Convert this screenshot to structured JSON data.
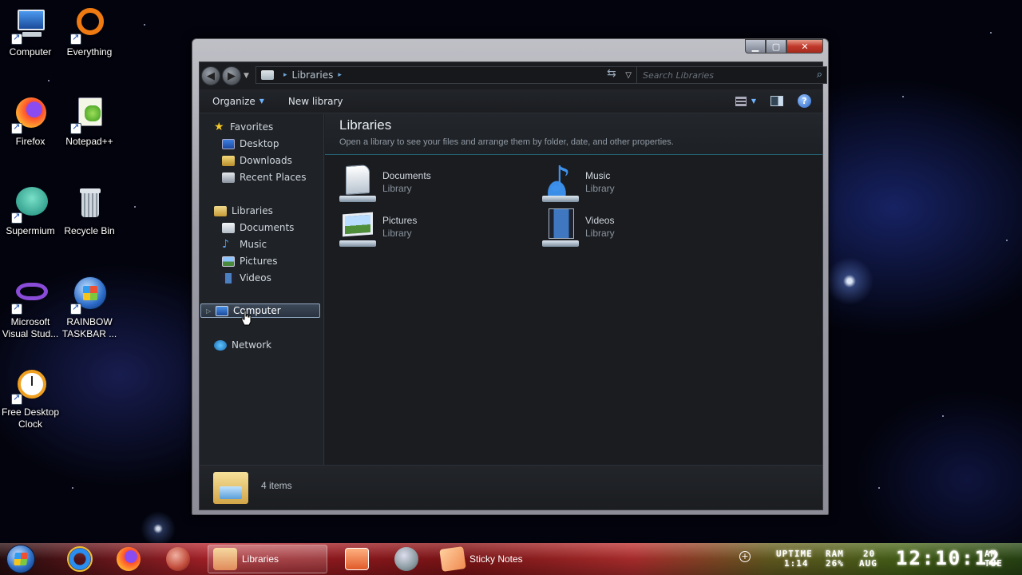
{
  "desktop": {
    "icons": [
      {
        "label": "Computer",
        "icon": "computer-icon"
      },
      {
        "label": "Everything",
        "icon": "everything-icon"
      },
      {
        "label": "Firefox",
        "icon": "firefox-icon"
      },
      {
        "label": "Notepad++",
        "icon": "notepad-plus-plus-icon"
      },
      {
        "label": "Supermium",
        "icon": "supermium-icon"
      },
      {
        "label": "Recycle Bin",
        "icon": "recycle-bin-icon"
      },
      {
        "label": "Microsoft Visual Stud...",
        "icon": "visual-studio-icon"
      },
      {
        "label": "RAINBOW TASKBAR ...",
        "icon": "rainbow-taskbar-icon"
      },
      {
        "label": "Free Desktop Clock",
        "icon": "alarm-clock-icon"
      }
    ]
  },
  "window": {
    "caption": {
      "minimize": "▁",
      "maximize": "▢",
      "close": "✕"
    },
    "address": {
      "crumb": "Libraries"
    },
    "search": {
      "placeholder": "Search Libraries"
    },
    "toolbar": {
      "organize": "Organize",
      "new_library": "New library"
    },
    "nav": {
      "favorites": "Favorites",
      "favorites_items": [
        "Desktop",
        "Downloads",
        "Recent Places"
      ],
      "libraries": "Libraries",
      "libraries_items": [
        "Documents",
        "Music",
        "Pictures",
        "Videos"
      ],
      "computer": "Computer",
      "network": "Network"
    },
    "content": {
      "title": "Libraries",
      "subtitle": "Open a library to see your files and arrange them by folder, date, and other properties.",
      "libraries": [
        {
          "name": "Documents",
          "type": "Library"
        },
        {
          "name": "Music",
          "type": "Library"
        },
        {
          "name": "Pictures",
          "type": "Library"
        },
        {
          "name": "Videos",
          "type": "Library"
        }
      ]
    },
    "details": {
      "count": "4 items"
    }
  },
  "taskbar": {
    "buttons": [
      {
        "label": "",
        "icon": "internet-explorer-icon"
      },
      {
        "label": "",
        "icon": "firefox-icon"
      },
      {
        "label": "",
        "icon": "windows-orb-icon"
      },
      {
        "label": "Libraries",
        "icon": "libraries-folder-icon"
      },
      {
        "label": "",
        "icon": "media-player-icon"
      },
      {
        "label": "",
        "icon": "globe-icon"
      },
      {
        "label": "Sticky Notes",
        "icon": "sticky-notes-icon"
      }
    ],
    "tray": {
      "uptime_label": "UPTIME",
      "uptime": "1:14",
      "ram_label": "RAM",
      "ram": "26%",
      "day": "20",
      "month": "AUG",
      "time": "12:10:12",
      "ampm": "AM",
      "weekday": "TUE"
    }
  },
  "colors": {
    "accent": "#6fb4ff",
    "selection_border": "#8fa6c0"
  }
}
